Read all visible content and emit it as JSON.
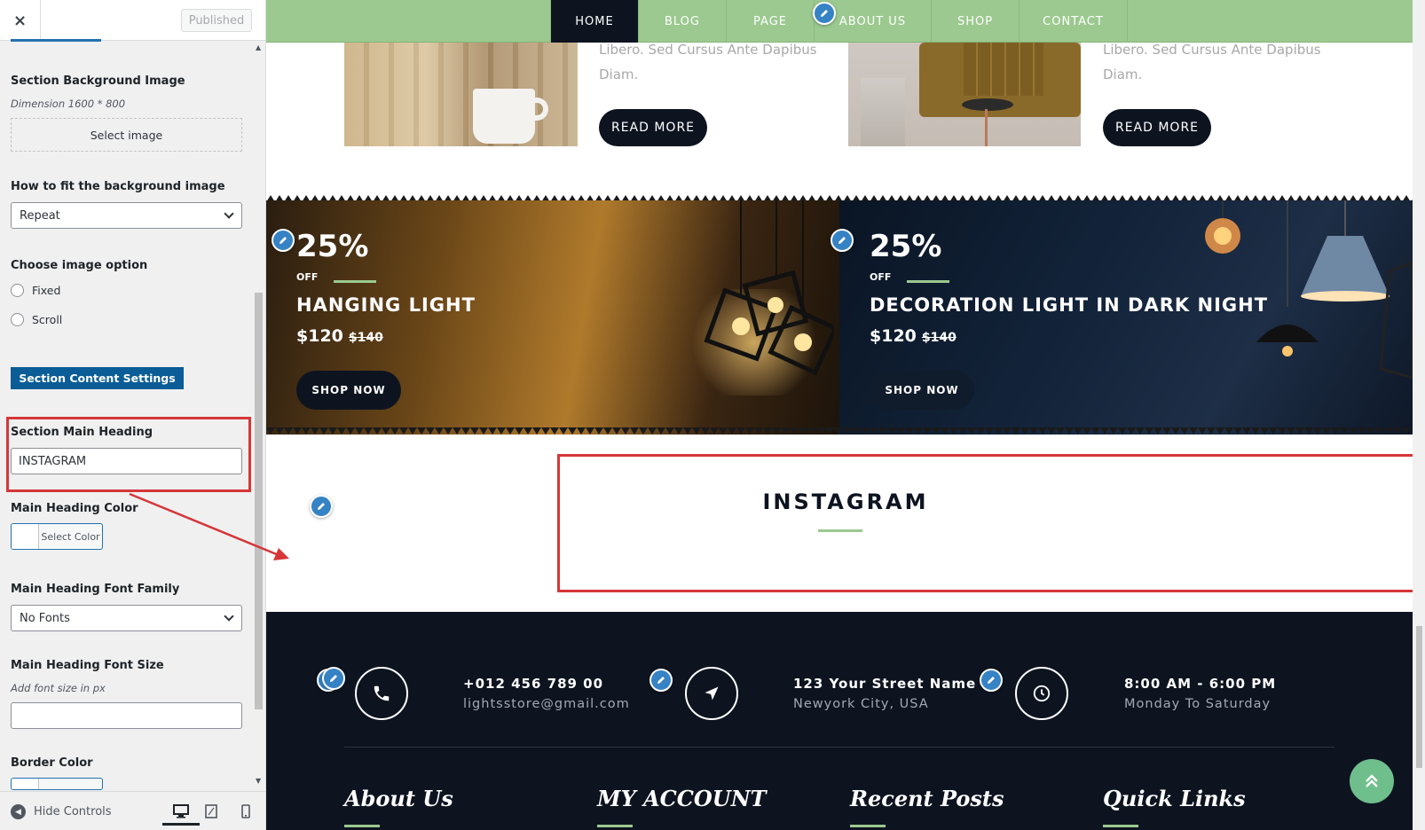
{
  "sidebar": {
    "close_symbol": "×",
    "publish_label": "Published",
    "bg_image_label": "Section Background Image",
    "bg_image_desc": "Dimension 1600 * 800",
    "select_image_label": "Select image",
    "fit_label": "How to fit the background image",
    "fit_value": "Repeat",
    "image_option_label": "Choose image option",
    "image_options": [
      "Fixed",
      "Scroll"
    ],
    "content_settings_label": "Section Content Settings",
    "main_heading_label": "Section Main Heading",
    "main_heading_value": "INSTAGRAM",
    "main_heading_color_label": "Main Heading Color",
    "select_color_label": "Select Color",
    "font_family_label": "Main Heading Font Family",
    "font_family_value": "No Fonts",
    "font_size_label": "Main Heading Font Size",
    "font_size_desc": "Add font size in px",
    "border_color_label": "Border Color",
    "hide_controls_label": "Hide Controls"
  },
  "nav": {
    "items": [
      "HOME",
      "BLOG",
      "PAGE",
      "ABOUT US",
      "SHOP",
      "CONTACT"
    ]
  },
  "cards": [
    {
      "text_line1": "Libero. Sed Cursus Ante Dapibus",
      "text_line2": "Diam.",
      "button": "READ MORE"
    },
    {
      "text_line1": "Libero. Sed Cursus Ante Dapibus",
      "text_line2": "Diam.",
      "button": "READ MORE"
    }
  ],
  "promos": [
    {
      "percent": "25%",
      "off": "OFF",
      "title": "HANGING LIGHT",
      "price": "$120",
      "old_price": "$140",
      "button": "SHOP NOW"
    },
    {
      "percent": "25%",
      "off": "OFF",
      "title": "DECORATION LIGHT IN DARK NIGHT",
      "price": "$120",
      "old_price": "$140",
      "button": "SHOP NOW"
    }
  ],
  "instagram": {
    "heading": "INSTAGRAM"
  },
  "footer": {
    "contacts": [
      {
        "icon": "phone-icon",
        "main": "+012 456 789 00",
        "sub": "lightsstore@gmail.com"
      },
      {
        "icon": "location-arrow-icon",
        "main": "123 Your Street Name",
        "sub": "Newyork City, USA"
      },
      {
        "icon": "clock-icon",
        "main": "8:00 AM - 6:00 PM",
        "sub": "Monday To Saturday"
      }
    ],
    "headings": [
      "About Us",
      "MY ACCOUNT",
      "Recent Posts",
      "Quick Links"
    ]
  },
  "colors": {
    "nav_bg": "#9bc98f",
    "dark": "#0d1420",
    "accent_green": "#9bc98f",
    "highlight_red": "#d63638",
    "wp_blue": "#2271b1"
  }
}
